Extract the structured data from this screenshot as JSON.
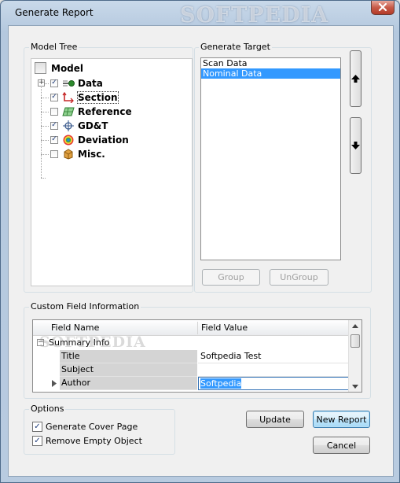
{
  "window": {
    "title": "Generate Report",
    "watermark": "SOFTPEDIA"
  },
  "model_tree": {
    "label": "Model Tree",
    "root": "Model",
    "items": [
      {
        "label": "Data",
        "checked": true,
        "icon": "data-arrow-icon",
        "expandable": true
      },
      {
        "label": "Section",
        "checked": true,
        "icon": "section-icon",
        "expandable": false
      },
      {
        "label": "Reference",
        "checked": false,
        "icon": "reference-plane-icon",
        "expandable": false
      },
      {
        "label": "GD&T",
        "checked": true,
        "icon": "crosshair-icon",
        "expandable": false
      },
      {
        "label": "Deviation",
        "checked": true,
        "icon": "deviation-target-icon",
        "expandable": false
      },
      {
        "label": "Misc.",
        "checked": false,
        "icon": "box-icon",
        "expandable": false
      }
    ]
  },
  "generate_target": {
    "label": "Generate Target",
    "items": [
      {
        "label": "Scan Data",
        "selected": false
      },
      {
        "label": "Nominal Data",
        "selected": true
      }
    ],
    "group_label": "Group",
    "ungroup_label": "UnGroup",
    "move_up_icon": "arrow-up-icon",
    "move_down_icon": "arrow-down-icon"
  },
  "custom_fields": {
    "label": "Custom Field Information",
    "col_name": "Field Name",
    "col_value": "Field Value",
    "category": "Summary Info",
    "watermark": "SOFTPEDIA",
    "rows": [
      {
        "name": "Title",
        "value": "Softpedia Test"
      },
      {
        "name": "Subject",
        "value": ""
      },
      {
        "name": "Author",
        "value": "Softpedia"
      }
    ]
  },
  "options": {
    "label": "Options",
    "generate_cover_page": {
      "label": "Generate Cover Page",
      "checked": true
    },
    "remove_empty_object": {
      "label": "Remove Empty Object",
      "checked": true
    }
  },
  "buttons": {
    "update": "Update",
    "new_report": "New Report",
    "cancel": "Cancel"
  },
  "colors": {
    "selection": "#3399ff",
    "title_bar": "#b4c8de",
    "client_bg": "#f0f0f0"
  }
}
